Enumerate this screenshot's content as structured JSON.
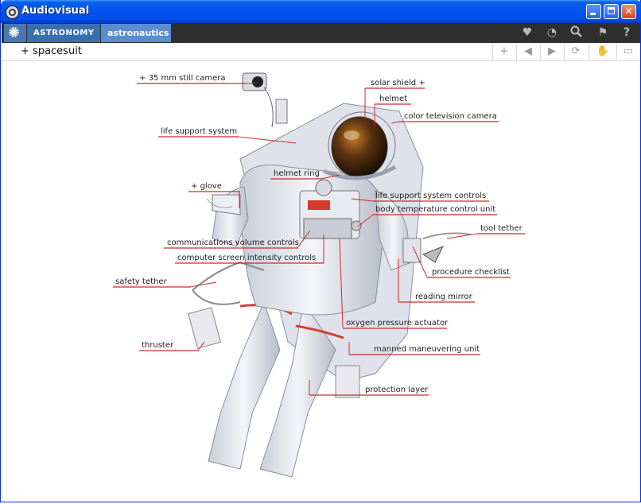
{
  "window": {
    "title": "Audiovisual"
  },
  "nav": {
    "section": "ASTRONOMY",
    "subsection": "astronautics"
  },
  "subtoolbar": {
    "title": "spacesuit",
    "plus": "+"
  },
  "labels": {
    "still_camera": "35 mm still camera",
    "life_support_system": "life support system",
    "glove": "glove",
    "helmet_ring": "helmet ring",
    "communications_volume_controls": "communications volume controls",
    "computer_screen_intensity_controls": "computer screen intensity controls",
    "safety_tether": "safety tether",
    "thruster": "thruster",
    "solar_shield": "solar shield",
    "helmet": "helmet",
    "color_television_camera": "color television camera",
    "life_support_system_controls": "life support system controls",
    "body_temperature_control_unit": "body temperature control unit",
    "tool_tether": "tool tether",
    "procedure_checklist": "procedure checklist",
    "reading_mirror": "reading mirror",
    "oxygen_pressure_actuator": "oxygen pressure actuator",
    "manned_maneuvering_unit": "manned maneuvering unit",
    "protection_layer": "protection layer"
  },
  "icons": [
    "heart-icon",
    "clock-icon",
    "search-icon",
    "flag-icon",
    "help-icon",
    "add-icon",
    "back-icon",
    "forward-icon",
    "refresh-icon",
    "hand-icon",
    "window-icon"
  ],
  "colors": {
    "titlebar": "#0053ee",
    "label_line": "#cc2b2b",
    "tab_active": "#5a8ccf"
  }
}
